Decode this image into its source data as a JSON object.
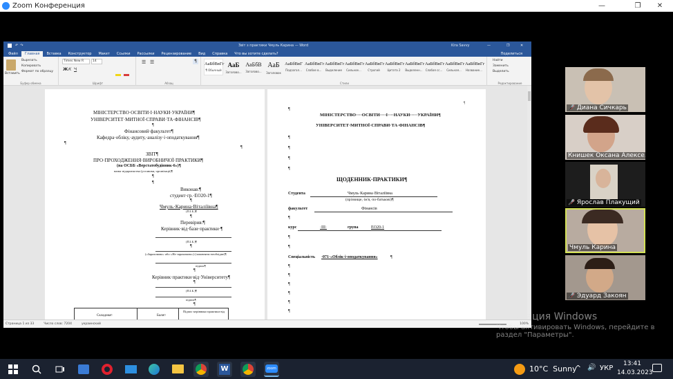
{
  "zoom": {
    "title": "Zoom Конференция",
    "controls": {
      "minimize": "—",
      "restore": "❐",
      "close": "✕"
    }
  },
  "word": {
    "doc_title": "Звіт з практики Чмуль Карина — Word",
    "user": "Kira Savvy",
    "tabs": [
      "Файл",
      "Главная",
      "Вставка",
      "Конструктор",
      "Макет",
      "Ссылки",
      "Рассылки",
      "Рецензирование",
      "Вид",
      "Справка",
      "Что вы хотите сделать?"
    ],
    "share_label": "Поделиться",
    "clipboard": {
      "paste": "Вставить",
      "cut": "Вырезать",
      "copy": "Копировать",
      "format": "Формат по образцу",
      "label": "Буфер обмена"
    },
    "font": {
      "name": "Times New R",
      "size": "14",
      "label": "Шрифт"
    },
    "paragraph_label": "Абзац",
    "styles": {
      "label": "Стили",
      "items": [
        {
          "sample": "АаБбВвГг",
          "name": "¶ Обычный"
        },
        {
          "sample": "АаБ",
          "name": "Заголово..."
        },
        {
          "sample": "АаБбВ",
          "name": "Заголово..."
        },
        {
          "sample": "АаБ",
          "name": "Заголовок"
        },
        {
          "sample": "АаБбВвГ",
          "name": "Подзагол..."
        },
        {
          "sample": "АаБбВвГг",
          "name": "Слабое в..."
        },
        {
          "sample": "АаБбВвГг",
          "name": "Выделение"
        },
        {
          "sample": "АаБбВвГг",
          "name": "Сильное..."
        },
        {
          "sample": "АаБбВвГг",
          "name": "Строгий"
        },
        {
          "sample": "АаБбВвГг",
          "name": "Цитата 2"
        },
        {
          "sample": "АаБбВвГг",
          "name": "Выделенн..."
        },
        {
          "sample": "АаБбВвГг",
          "name": "Слабая сс..."
        },
        {
          "sample": "АаБбВвГг",
          "name": "Сильная..."
        },
        {
          "sample": "АаБбВвГг",
          "name": "Название..."
        }
      ]
    },
    "editing": {
      "find": "Найти",
      "replace": "Заменить",
      "select": "Выделить",
      "label": "Редактирование"
    },
    "status": {
      "page": "Страница 1 из 33",
      "words": "Число слов: 7204",
      "lang": "украинский",
      "zoom": "100%"
    }
  },
  "page_left": {
    "lines": [
      "МІНІСТЕРСТВО·ОСВІТИ·І·НАУКИ·УКРАЇНИ¶",
      "УНІВЕРСИТЕТ·МИТНОЇ·СПРАВИ·ТА·ФІНАНСІВ¶",
      "¶",
      "Фінансовий·факультет¶",
      "Кафедра·обліку,·аудиту,·аналізу·і·оподаткування¶",
      "¶",
      "¶",
      "ЗВІТ¶",
      "ПРО·ПРОХОДЖЕННЯ·ВИРОБНИЧОЇ·ПРАКТИКИ¶",
      "(на ОСББ «Верстатобудівник-6»)¶",
      "назва·підприємства·(установи,·організації)¶",
      "¶",
      "¶",
      "Виконав:¶",
      "студент·гр.·ЕО20-1¶",
      "¶",
      "Чмуль·Карина·Віталіївна¶",
      "(П.І.Б.)¶",
      "¶",
      "Перевірив:¶",
      "Керівник·від·бази·практики·¶",
      "(П.І.Б.)¶",
      "¶",
      "(«Зараховано»·або·«Не·зараховано»)·(заповнити·необхідне)¶",
      "підпис¶",
      "¶",
      "Керівник·практики·від·Університету¶",
      "¶",
      "(П.І.Б.)¶",
      "підпис¶",
      "¶"
    ],
    "table_headers": [
      "Складова¤",
      "Бали¤",
      "Підпис·керівника·практики·від"
    ]
  },
  "page_right": {
    "lines": [
      "МІНІСТЕРСТВО····ОСВІТИ····І····НАУКИ·····УКРАЇНИ¶",
      "УНІВЕРСИТЕТ·МИТНОЇ·СПРАВИ·ТА·ФІНАНСІВ¶",
      "ЩОДЕННИК·ПРАКТИКИ¶",
      "Студента",
      "Чмуль·Карина·Віталіївна",
      "(прізвище,·ім'я,·по-батькові)¶",
      "факультет",
      "Фінансів",
      "курс",
      "·III·",
      "група",
      "ЕО20-1",
      "Спеціальність",
      "·071·«Облік·і·оподаткування»",
      "¶"
    ]
  },
  "participants": [
    {
      "name": "Диана Сичкарь",
      "muted": true
    },
    {
      "name": "Книшек Оксана Алексе...",
      "muted": false
    },
    {
      "name": "Ярослав Плакущий",
      "muted": true
    },
    {
      "name": "Чмуль Карина",
      "muted": false,
      "active": true
    },
    {
      "name": "Эдуард Закоян",
      "muted": true
    }
  ],
  "watermark": {
    "title": "Активация Windows",
    "line1": "Чтобы активировать Windows, перейдите в",
    "line2": "раздел \"Параметры\"."
  },
  "taskbar": {
    "weather": "10°C  Sunny",
    "lang": "УКР",
    "time": "13:41",
    "date": "14.03.2023",
    "zoom_label": "zoom"
  },
  "colors": {
    "word_blue": "#2b579a",
    "zoom_blue": "#2d8cff",
    "active_border": "#d4e157",
    "taskbar": "#1b2230"
  }
}
